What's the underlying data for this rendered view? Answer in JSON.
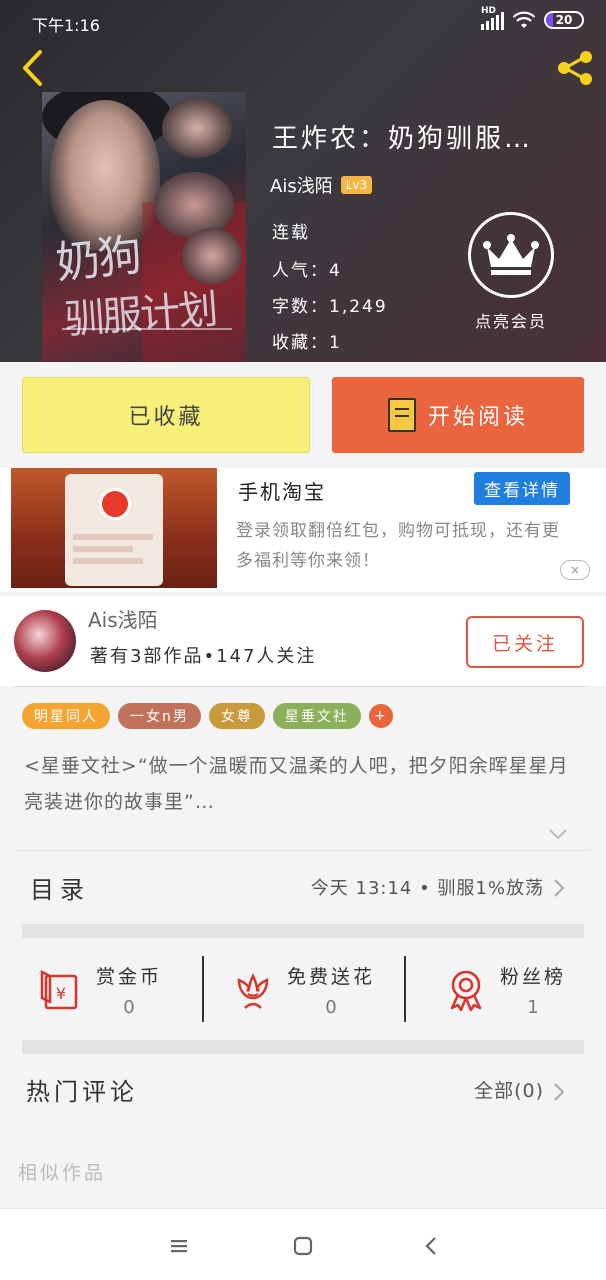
{
  "status_bar": {
    "time": "下午1:16",
    "battery": "20",
    "battery_level": 0.2
  },
  "header": {
    "book_title": "王炸农：奶狗驯服…",
    "author": "Ais浅陌",
    "level": "Lv3",
    "status": "连载",
    "popularity": "人气：4",
    "word_count": "字数：1,249",
    "favorites": "收藏：1",
    "vip_label": "点亮会员",
    "cover_title_line1": "奶狗",
    "cover_title_line2": "驯服计划"
  },
  "actions": {
    "collected_label": "已收藏",
    "read_label": "开始阅读"
  },
  "ad": {
    "title": "手机淘宝",
    "detail_label": "查看详情",
    "description": "登录领取翻倍红包，购物可抵现，还有更多福利等你来领！",
    "close_icon": "×"
  },
  "author_card": {
    "name": "Ais浅陌",
    "stats": "著有3部作品•147人关注",
    "follow_label": "已关注"
  },
  "tags": [
    {
      "label": "明星同人",
      "color": "#f5a432"
    },
    {
      "label": "一女n男",
      "color": "#c2715a"
    },
    {
      "label": "女尊",
      "color": "#c99a3a"
    },
    {
      "label": "星垂文社",
      "color": "#8bb05c"
    }
  ],
  "tag_more": "+",
  "synopsis": "<星垂文社>“做一个温暖而又温柔的人吧，把夕阳余晖星星月亮装进你的故事里”…",
  "catalog": {
    "label": "目录",
    "latest": "今天 13:14 • 驯服1%放荡"
  },
  "stats": [
    {
      "label": "赏金币",
      "value": "0",
      "icon": "red-envelope-icon"
    },
    {
      "label": "免费送花",
      "value": "0",
      "icon": "flower-icon"
    },
    {
      "label": "粉丝榜",
      "value": "1",
      "icon": "medal-icon"
    }
  ],
  "comments": {
    "label": "热门评论",
    "all_label": "全部(0)"
  },
  "similar_label": "相似作品",
  "colors": {
    "accent_orange": "#ea653e",
    "collected_yellow": "#f8ef7a",
    "follow_red": "#e0563f",
    "ad_blue": "#1f7ee0"
  }
}
